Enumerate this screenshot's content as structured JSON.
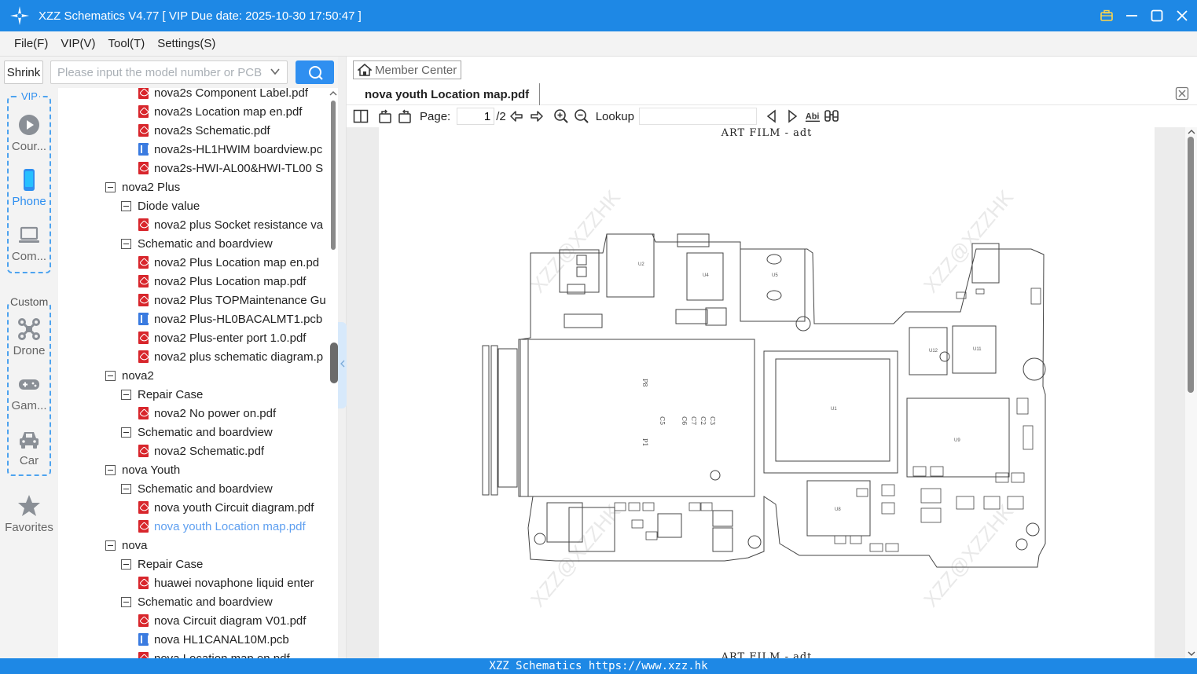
{
  "window": {
    "title": "XZZ Schematics V4.77 [ VIP Due date: 2025-10-30 17:50:47 ]"
  },
  "menu": [
    "File(F)",
    "VIP(V)",
    "Tool(T)",
    "Settings(S)"
  ],
  "search": {
    "shrink_label": "Shrink",
    "placeholder": "Please input the model number or PCB"
  },
  "categories": {
    "vip_label": "VIP",
    "custom_label": "Custom",
    "items": [
      {
        "label": "Cour...",
        "icon": "play-icon"
      },
      {
        "label": "Phone",
        "icon": "phone-icon",
        "active": true
      },
      {
        "label": "Com...",
        "icon": "laptop-icon"
      },
      {
        "label": "Drone",
        "icon": "drone-icon"
      },
      {
        "label": "Gam...",
        "icon": "gamepad-icon"
      },
      {
        "label": "Car",
        "icon": "car-icon"
      },
      {
        "label": "Favorites",
        "icon": "star-icon"
      }
    ]
  },
  "tree": [
    {
      "level": 3,
      "type": "pdf",
      "label": "nova2s Component Label.pdf"
    },
    {
      "level": 3,
      "type": "pdf",
      "label": "nova2s Location map en.pdf"
    },
    {
      "level": 3,
      "type": "pdf",
      "label": "nova2s Schematic.pdf"
    },
    {
      "level": 3,
      "type": "pcb",
      "label": "nova2s-HL1HWIM boardview.pc"
    },
    {
      "level": 3,
      "type": "pdf",
      "label": "nova2s-HWI-AL00&HWI-TL00 S"
    },
    {
      "level": 1,
      "type": "folder",
      "label": "nova2 Plus"
    },
    {
      "level": 2,
      "type": "folder",
      "label": "Diode value"
    },
    {
      "level": 3,
      "type": "pdf",
      "label": "nova2 plus Socket resistance va"
    },
    {
      "level": 2,
      "type": "folder",
      "label": "Schematic and boardview"
    },
    {
      "level": 3,
      "type": "pdf",
      "label": "nova2 Plus Location map en.pd"
    },
    {
      "level": 3,
      "type": "pdf",
      "label": "nova2 Plus Location map.pdf"
    },
    {
      "level": 3,
      "type": "pdf",
      "label": "nova2 Plus TOPMaintenance Gu"
    },
    {
      "level": 3,
      "type": "pcb",
      "label": "nova2 Plus-HL0BACALMT1.pcb"
    },
    {
      "level": 3,
      "type": "pdf",
      "label": "nova2 Plus-enter port 1.0.pdf"
    },
    {
      "level": 3,
      "type": "pdf",
      "label": "nova2 plus schematic diagram.p"
    },
    {
      "level": 1,
      "type": "folder",
      "label": "nova2"
    },
    {
      "level": 2,
      "type": "folder",
      "label": "Repair Case"
    },
    {
      "level": 3,
      "type": "pdf",
      "label": "nova2 No power on.pdf"
    },
    {
      "level": 2,
      "type": "folder",
      "label": "Schematic and boardview"
    },
    {
      "level": 3,
      "type": "pdf",
      "label": "nova2 Schematic.pdf"
    },
    {
      "level": 1,
      "type": "folder",
      "label": "nova Youth"
    },
    {
      "level": 2,
      "type": "folder",
      "label": "Schematic and boardview"
    },
    {
      "level": 3,
      "type": "pdf",
      "label": "nova youth Circuit diagram.pdf"
    },
    {
      "level": 3,
      "type": "pdf",
      "label": "nova youth Location map.pdf",
      "selected": true
    },
    {
      "level": 1,
      "type": "folder",
      "label": "nova"
    },
    {
      "level": 2,
      "type": "folder",
      "label": "Repair Case"
    },
    {
      "level": 3,
      "type": "pdf",
      "label": "huawei novaphone liquid enter"
    },
    {
      "level": 2,
      "type": "folder",
      "label": "Schematic and boardview"
    },
    {
      "level": 3,
      "type": "pdf",
      "label": "nova Circuit diagram V01.pdf"
    },
    {
      "level": 3,
      "type": "pcb",
      "label": "nova HL1CANAL10M.pcb"
    },
    {
      "level": 3,
      "type": "pdf",
      "label": "nova Location map en.pdf"
    }
  ],
  "viewer": {
    "member_center": "Member Center",
    "tab_title": "nova youth Location map.pdf",
    "page_label": "Page:",
    "page_value": "1",
    "page_total": "/2",
    "lookup_label": "Lookup",
    "doc_title": "ART FILM - adt",
    "doc_title_next": "ART FILM - adt",
    "watermark": "XZZ@XZZHK"
  },
  "statusbar": "XZZ Schematics https://www.xzz.hk",
  "colors": {
    "accent": "#1e88e5",
    "button": "#2f8ff0",
    "selected_text": "#5e9ff0",
    "pdf_icon": "#d8262c",
    "pcb_icon": "#3a7be0"
  }
}
